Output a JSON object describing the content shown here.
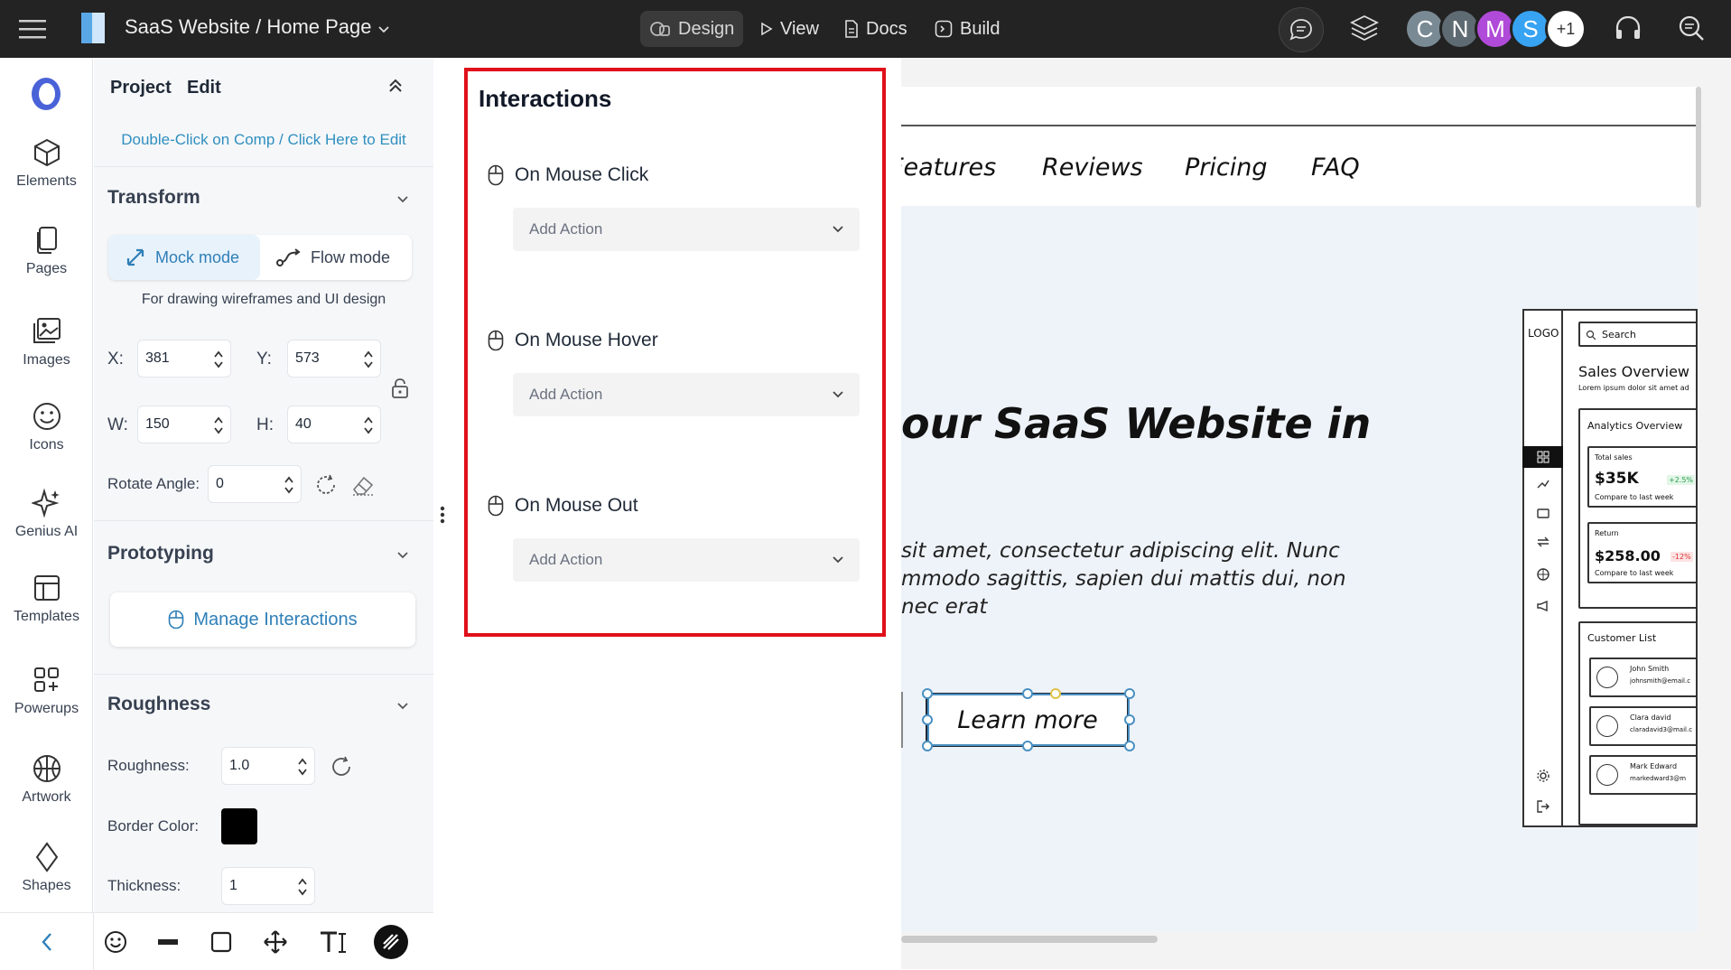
{
  "topbar": {
    "project_title": "SaaS Website / Home Page",
    "nav": {
      "design": "Design",
      "view": "View",
      "docs": "Docs",
      "build": "Build"
    },
    "avatars": [
      {
        "letter": "C",
        "color": "#7a8a95"
      },
      {
        "letter": "N",
        "color": "#5f6b73"
      },
      {
        "letter": "M",
        "color": "#b04ad8"
      },
      {
        "letter": "S",
        "color": "#38a3f2"
      }
    ],
    "extra_count": "+1"
  },
  "rail": {
    "items": [
      {
        "label": "Elements",
        "icon": "cube-icon"
      },
      {
        "label": "Pages",
        "icon": "pages-icon"
      },
      {
        "label": "Images",
        "icon": "images-icon"
      },
      {
        "label": "Icons",
        "icon": "smiley-icon"
      },
      {
        "label": "Genius AI",
        "icon": "sparkle-icon"
      },
      {
        "label": "Templates",
        "icon": "templates-icon"
      },
      {
        "label": "Powerups",
        "icon": "powerups-icon"
      },
      {
        "label": "Artwork",
        "icon": "artwork-icon"
      },
      {
        "label": "Shapes",
        "icon": "diamond-icon"
      }
    ]
  },
  "panel": {
    "tabs": {
      "project": "Project",
      "edit": "Edit"
    },
    "hint": "Double-Click on Comp / Click Here to Edit",
    "transform": {
      "title": "Transform",
      "mock_mode": "Mock mode",
      "flow_mode": "Flow mode",
      "caption": "For drawing wireframes and UI design",
      "x_label": "X:",
      "x_value": "381",
      "y_label": "Y:",
      "y_value": "573",
      "w_label": "W:",
      "w_value": "150",
      "h_label": "H:",
      "h_value": "40",
      "rotate_label": "Rotate Angle:",
      "rotate_value": "0"
    },
    "prototyping": {
      "title": "Prototyping",
      "manage": "Manage Interactions"
    },
    "roughness": {
      "title": "Roughness",
      "roughness_label": "Roughness:",
      "roughness_value": "1.0",
      "border_color_label": "Border Color:",
      "border_color": "#000000",
      "thickness_label": "Thickness:",
      "thickness_value": "1"
    }
  },
  "interactions": {
    "title": "Interactions",
    "events": [
      {
        "label": "On Mouse Click",
        "action_placeholder": "Add Action"
      },
      {
        "label": "On Mouse Hover",
        "action_placeholder": "Add Action"
      },
      {
        "label": "On Mouse Out",
        "action_placeholder": "Add Action"
      }
    ]
  },
  "canvas": {
    "nav_links": [
      "Features",
      "Reviews",
      "Pricing",
      "FAQ"
    ],
    "hero_title": "our SaaS Website in",
    "hero_body": [
      "sit amet, consectetur adipiscing elit. Nunc",
      "mmodo sagittis, sapien dui mattis dui, non",
      "nec erat"
    ],
    "cta": "Learn more",
    "dashboard": {
      "logo": "LOGO",
      "search": "Search",
      "title": "Sales Overview",
      "subtitle": "Lorem ipsum dolor sit amet ad",
      "analytics": "Analytics Overview",
      "total_sales_label": "Total sales",
      "total_sales": "$35K",
      "total_sales_delta": "+2.5%",
      "compare1": "Compare to last week",
      "return_label": "Return",
      "return_value": "$258.00",
      "return_delta": "-12%",
      "compare2": "Compare to last week",
      "customer_list": "Customer List",
      "customers": [
        {
          "name": "John Smith",
          "email": "johnsmith@email.c"
        },
        {
          "name": "Clara david",
          "email": "claradavid3@mail.c"
        },
        {
          "name": "Mark Edward",
          "email": "markedward3@m"
        }
      ]
    }
  },
  "colors": {
    "accent": "#2f7fb8",
    "highlight": "#e0101a",
    "topbar": "#232323"
  }
}
